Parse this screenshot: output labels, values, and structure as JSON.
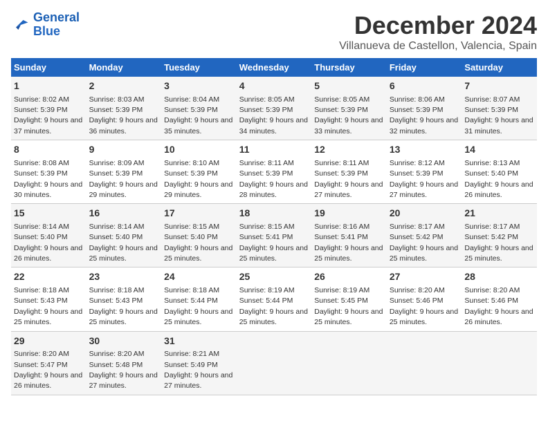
{
  "logo": {
    "line1": "General",
    "line2": "Blue"
  },
  "title": "December 2024",
  "location": "Villanueva de Castellon, Valencia, Spain",
  "days_header": [
    "Sunday",
    "Monday",
    "Tuesday",
    "Wednesday",
    "Thursday",
    "Friday",
    "Saturday"
  ],
  "weeks": [
    [
      {
        "num": "1",
        "sunrise": "Sunrise: 8:02 AM",
        "sunset": "Sunset: 5:39 PM",
        "daylight": "Daylight: 9 hours and 37 minutes."
      },
      {
        "num": "2",
        "sunrise": "Sunrise: 8:03 AM",
        "sunset": "Sunset: 5:39 PM",
        "daylight": "Daylight: 9 hours and 36 minutes."
      },
      {
        "num": "3",
        "sunrise": "Sunrise: 8:04 AM",
        "sunset": "Sunset: 5:39 PM",
        "daylight": "Daylight: 9 hours and 35 minutes."
      },
      {
        "num": "4",
        "sunrise": "Sunrise: 8:05 AM",
        "sunset": "Sunset: 5:39 PM",
        "daylight": "Daylight: 9 hours and 34 minutes."
      },
      {
        "num": "5",
        "sunrise": "Sunrise: 8:05 AM",
        "sunset": "Sunset: 5:39 PM",
        "daylight": "Daylight: 9 hours and 33 minutes."
      },
      {
        "num": "6",
        "sunrise": "Sunrise: 8:06 AM",
        "sunset": "Sunset: 5:39 PM",
        "daylight": "Daylight: 9 hours and 32 minutes."
      },
      {
        "num": "7",
        "sunrise": "Sunrise: 8:07 AM",
        "sunset": "Sunset: 5:39 PM",
        "daylight": "Daylight: 9 hours and 31 minutes."
      }
    ],
    [
      {
        "num": "8",
        "sunrise": "Sunrise: 8:08 AM",
        "sunset": "Sunset: 5:39 PM",
        "daylight": "Daylight: 9 hours and 30 minutes."
      },
      {
        "num": "9",
        "sunrise": "Sunrise: 8:09 AM",
        "sunset": "Sunset: 5:39 PM",
        "daylight": "Daylight: 9 hours and 29 minutes."
      },
      {
        "num": "10",
        "sunrise": "Sunrise: 8:10 AM",
        "sunset": "Sunset: 5:39 PM",
        "daylight": "Daylight: 9 hours and 29 minutes."
      },
      {
        "num": "11",
        "sunrise": "Sunrise: 8:11 AM",
        "sunset": "Sunset: 5:39 PM",
        "daylight": "Daylight: 9 hours and 28 minutes."
      },
      {
        "num": "12",
        "sunrise": "Sunrise: 8:11 AM",
        "sunset": "Sunset: 5:39 PM",
        "daylight": "Daylight: 9 hours and 27 minutes."
      },
      {
        "num": "13",
        "sunrise": "Sunrise: 8:12 AM",
        "sunset": "Sunset: 5:39 PM",
        "daylight": "Daylight: 9 hours and 27 minutes."
      },
      {
        "num": "14",
        "sunrise": "Sunrise: 8:13 AM",
        "sunset": "Sunset: 5:40 PM",
        "daylight": "Daylight: 9 hours and 26 minutes."
      }
    ],
    [
      {
        "num": "15",
        "sunrise": "Sunrise: 8:14 AM",
        "sunset": "Sunset: 5:40 PM",
        "daylight": "Daylight: 9 hours and 26 minutes."
      },
      {
        "num": "16",
        "sunrise": "Sunrise: 8:14 AM",
        "sunset": "Sunset: 5:40 PM",
        "daylight": "Daylight: 9 hours and 25 minutes."
      },
      {
        "num": "17",
        "sunrise": "Sunrise: 8:15 AM",
        "sunset": "Sunset: 5:40 PM",
        "daylight": "Daylight: 9 hours and 25 minutes."
      },
      {
        "num": "18",
        "sunrise": "Sunrise: 8:15 AM",
        "sunset": "Sunset: 5:41 PM",
        "daylight": "Daylight: 9 hours and 25 minutes."
      },
      {
        "num": "19",
        "sunrise": "Sunrise: 8:16 AM",
        "sunset": "Sunset: 5:41 PM",
        "daylight": "Daylight: 9 hours and 25 minutes."
      },
      {
        "num": "20",
        "sunrise": "Sunrise: 8:17 AM",
        "sunset": "Sunset: 5:42 PM",
        "daylight": "Daylight: 9 hours and 25 minutes."
      },
      {
        "num": "21",
        "sunrise": "Sunrise: 8:17 AM",
        "sunset": "Sunset: 5:42 PM",
        "daylight": "Daylight: 9 hours and 25 minutes."
      }
    ],
    [
      {
        "num": "22",
        "sunrise": "Sunrise: 8:18 AM",
        "sunset": "Sunset: 5:43 PM",
        "daylight": "Daylight: 9 hours and 25 minutes."
      },
      {
        "num": "23",
        "sunrise": "Sunrise: 8:18 AM",
        "sunset": "Sunset: 5:43 PM",
        "daylight": "Daylight: 9 hours and 25 minutes."
      },
      {
        "num": "24",
        "sunrise": "Sunrise: 8:18 AM",
        "sunset": "Sunset: 5:44 PM",
        "daylight": "Daylight: 9 hours and 25 minutes."
      },
      {
        "num": "25",
        "sunrise": "Sunrise: 8:19 AM",
        "sunset": "Sunset: 5:44 PM",
        "daylight": "Daylight: 9 hours and 25 minutes."
      },
      {
        "num": "26",
        "sunrise": "Sunrise: 8:19 AM",
        "sunset": "Sunset: 5:45 PM",
        "daylight": "Daylight: 9 hours and 25 minutes."
      },
      {
        "num": "27",
        "sunrise": "Sunrise: 8:20 AM",
        "sunset": "Sunset: 5:46 PM",
        "daylight": "Daylight: 9 hours and 25 minutes."
      },
      {
        "num": "28",
        "sunrise": "Sunrise: 8:20 AM",
        "sunset": "Sunset: 5:46 PM",
        "daylight": "Daylight: 9 hours and 26 minutes."
      }
    ],
    [
      {
        "num": "29",
        "sunrise": "Sunrise: 8:20 AM",
        "sunset": "Sunset: 5:47 PM",
        "daylight": "Daylight: 9 hours and 26 minutes."
      },
      {
        "num": "30",
        "sunrise": "Sunrise: 8:20 AM",
        "sunset": "Sunset: 5:48 PM",
        "daylight": "Daylight: 9 hours and 27 minutes."
      },
      {
        "num": "31",
        "sunrise": "Sunrise: 8:21 AM",
        "sunset": "Sunset: 5:49 PM",
        "daylight": "Daylight: 9 hours and 27 minutes."
      },
      null,
      null,
      null,
      null
    ]
  ]
}
